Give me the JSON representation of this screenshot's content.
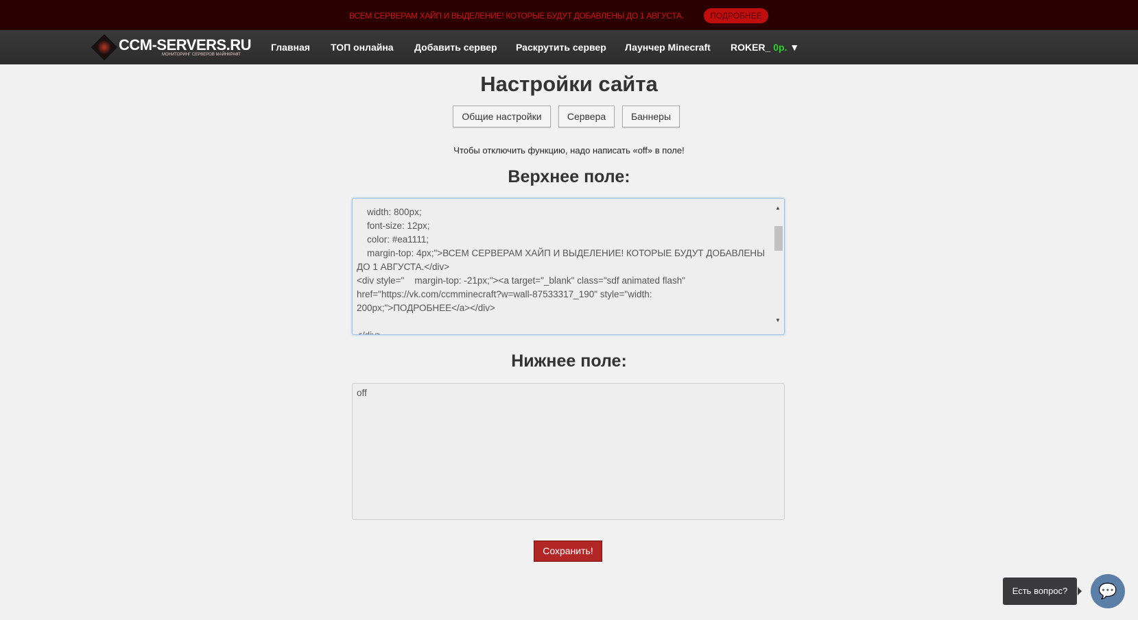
{
  "announcement": {
    "text": "ВСЕМ СЕРВЕРАМ ХАЙП И ВЫДЕЛЕНИЕ! КОТОРЫЕ БУДУТ ДОБАВЛЕНЫ ДО 1 АВГУСТА.",
    "button": "ПОДРОБНЕЕ"
  },
  "logo": {
    "title": "CCM-SERVERS.RU",
    "subtitle": "МОНИТОРИНГ СЕРВЕРОВ МАЙНКРАФТ"
  },
  "nav": {
    "items": [
      "Главная",
      "ТОП онлайна",
      "Добавить сервер",
      "Раскрутить сервер",
      "Лаунчер Minecraft"
    ],
    "user": "ROKER_",
    "balance": "0р.",
    "caret": "▼"
  },
  "page": {
    "title": "Настройки сайта",
    "tabs": [
      "Общие настройки",
      "Сервера",
      "Баннеры"
    ],
    "note": "Чтобы отключить функцию, надо написать «off» в поле!"
  },
  "top_field": {
    "label": "Верхнее поле:",
    "value": "    width: 800px;\n    font-size: 12px;\n    color: #ea1111;\n    margin-top: 4px;\">ВСЕМ СЕРВЕРАМ ХАЙП И ВЫДЕЛЕНИЕ! КОТОРЫЕ БУДУТ ДОБАВЛЕНЫ ДО 1 АВГУСТА.</div>\n<div style=\"    margin-top: -21px;\"><a target=\"_blank\" class=\"sdf animated flash\" href=\"https://vk.com/ccmminecraft?w=wall-87533317_190\" style=\"width: 200px;\">ПОДРОБНЕЕ</a></div>\n\n</div>"
  },
  "bottom_field": {
    "label": "Нижнее поле:",
    "value": "off"
  },
  "save": "Сохранить!",
  "chat": {
    "tooltip": "Есть вопрос?"
  }
}
